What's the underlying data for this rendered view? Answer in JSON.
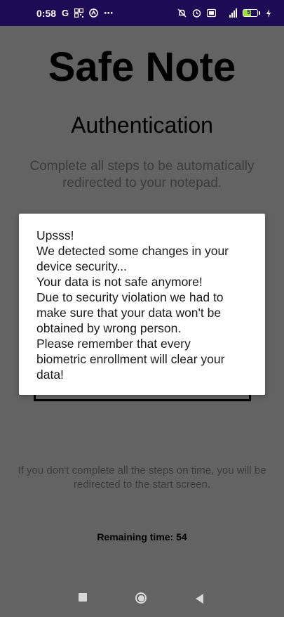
{
  "status_bar": {
    "time": "0:58",
    "left_icons": [
      "google-icon",
      "qr-icon",
      "app-icon",
      "more-icon"
    ],
    "right_icons": [
      "notifications-off-icon",
      "alarm-icon",
      "volte-icon",
      "lte-signal-icon",
      "battery-icon",
      "charging-icon"
    ],
    "battery_level": "57",
    "battery_fraction": 0.57,
    "lte_label": "LTE"
  },
  "app": {
    "title": "Safe Note",
    "subtitle": "Authentication",
    "instructions": "Complete all steps to be automatically redirected to your notepad.",
    "warning": "If you don't complete all the steps on time, you will be redirected to the start screen.",
    "remaining_time": "Remaining time: 54"
  },
  "dialog": {
    "lines": [
      "Upsss!",
      "We detected some changes in your",
      "device security...",
      "Your data is not safe anymore!",
      "Due to security violation we had to",
      "make sure that your data won't be",
      "obtained by wrong person.",
      "Please remember that every",
      "biometric enrollment will clear your",
      "data!"
    ]
  },
  "nav_bar": {
    "buttons": [
      "recents-icon",
      "home-icon",
      "back-icon"
    ]
  },
  "colors": {
    "status_bar_bg": "#1f0a55",
    "scrim_bg": "#636363",
    "dialog_bg": "#ffffff",
    "battery_fill": "#9adf3c"
  }
}
